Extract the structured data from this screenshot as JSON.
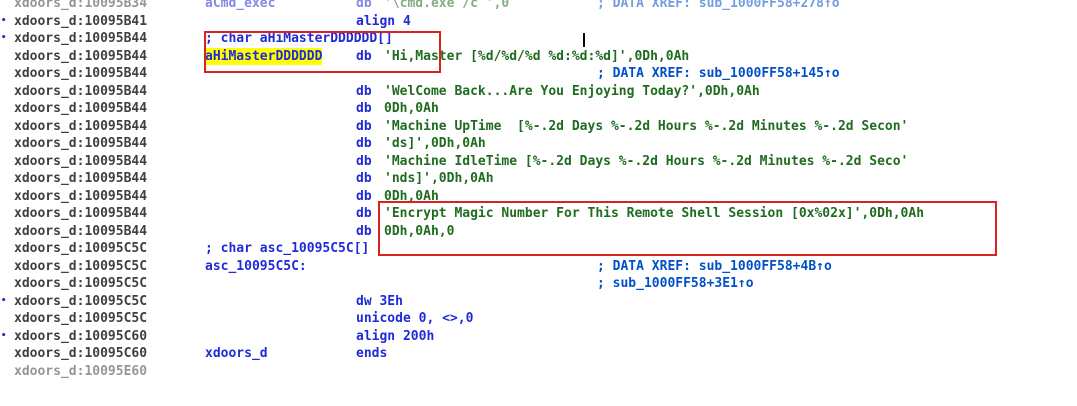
{
  "lines": [
    {
      "bullet": "",
      "addr": "xdoors_d:10095B34",
      "label": "aCmd_exec",
      "mnemonic": "db",
      "operands": "'\\cmd.exe /c ',0",
      "comment": "; DATA XREF: sub_1000FF58+278↑o"
    },
    {
      "bullet": "•",
      "addr": "xdoors_d:10095B41",
      "label": "",
      "mnemonic": "align 4",
      "operands": "",
      "comment": ""
    },
    {
      "bullet": "•",
      "addr": "xdoors_d:10095B44",
      "label": "; char aHiMasterDDDDDD[]",
      "mnemonic": "",
      "operands": "",
      "comment": ""
    },
    {
      "bullet": "",
      "addr": "xdoors_d:10095B44",
      "label": "aHiMasterDDDDDD",
      "mnemonic": "db",
      "operands": "'Hi,Master [%d/%d/%d %d:%d:%d]',0Dh,0Ah",
      "comment": ""
    },
    {
      "bullet": "",
      "addr": "xdoors_d:10095B44",
      "label": "",
      "mnemonic": "",
      "operands": "",
      "comment": "; DATA XREF: sub_1000FF58+145↑o"
    },
    {
      "bullet": "",
      "addr": "xdoors_d:10095B44",
      "label": "",
      "mnemonic": "db",
      "operands": "'WelCome Back...Are You Enjoying Today?',0Dh,0Ah",
      "comment": ""
    },
    {
      "bullet": "",
      "addr": "xdoors_d:10095B44",
      "label": "",
      "mnemonic": "db",
      "operands": "0Dh,0Ah",
      "comment": ""
    },
    {
      "bullet": "",
      "addr": "xdoors_d:10095B44",
      "label": "",
      "mnemonic": "db",
      "operands": "'Machine UpTime  [%-.2d Days %-.2d Hours %-.2d Minutes %-.2d Secon'",
      "comment": ""
    },
    {
      "bullet": "",
      "addr": "xdoors_d:10095B44",
      "label": "",
      "mnemonic": "db",
      "operands": "'ds]',0Dh,0Ah",
      "comment": ""
    },
    {
      "bullet": "",
      "addr": "xdoors_d:10095B44",
      "label": "",
      "mnemonic": "db",
      "operands": "'Machine IdleTime [%-.2d Days %-.2d Hours %-.2d Minutes %-.2d Seco'",
      "comment": ""
    },
    {
      "bullet": "",
      "addr": "xdoors_d:10095B44",
      "label": "",
      "mnemonic": "db",
      "operands": "'nds]',0Dh,0Ah",
      "comment": ""
    },
    {
      "bullet": "",
      "addr": "xdoors_d:10095B44",
      "label": "",
      "mnemonic": "db",
      "operands": "0Dh,0Ah",
      "comment": ""
    },
    {
      "bullet": "",
      "addr": "xdoors_d:10095B44",
      "label": "",
      "mnemonic": "db",
      "operands": "'Encrypt Magic Number For This Remote Shell Session [0x%02x]',0Dh,0Ah",
      "comment": ""
    },
    {
      "bullet": "",
      "addr": "xdoors_d:10095B44",
      "label": "",
      "mnemonic": "db",
      "operands": "0Dh,0Ah,0",
      "comment": ""
    },
    {
      "bullet": "",
      "addr": "xdoors_d:10095C5C",
      "label": "; char asc_10095C5C[]",
      "mnemonic": "",
      "operands": "",
      "comment": ""
    },
    {
      "bullet": "",
      "addr": "xdoors_d:10095C5C",
      "label": "asc_10095C5C:",
      "mnemonic": "",
      "operands": "",
      "comment": "; DATA XREF: sub_1000FF58+4B↑o"
    },
    {
      "bullet": "",
      "addr": "xdoors_d:10095C5C",
      "label": "",
      "mnemonic": "",
      "operands": "",
      "comment": "; sub_1000FF58+3E1↑o"
    },
    {
      "bullet": "•",
      "addr": "xdoors_d:10095C5C",
      "label": "",
      "mnemonic": "dw 3Eh",
      "operands": "",
      "comment": ""
    },
    {
      "bullet": "",
      "addr": "xdoors_d:10095C5C",
      "label": "",
      "mnemonic": "unicode 0, <>,0",
      "operands": "",
      "comment": ""
    },
    {
      "bullet": "•",
      "addr": "xdoors_d:10095C60",
      "label": "",
      "mnemonic": "align 200h",
      "operands": "",
      "comment": ""
    },
    {
      "bullet": "",
      "addr": "xdoors_d:10095C60",
      "label": "xdoors_d",
      "mnemonic": "ends",
      "operands": "",
      "comment": ""
    },
    {
      "bullet": "",
      "addr": "xdoors_d:10095E60",
      "label": "",
      "mnemonic": "",
      "operands": "",
      "comment": ""
    }
  ]
}
